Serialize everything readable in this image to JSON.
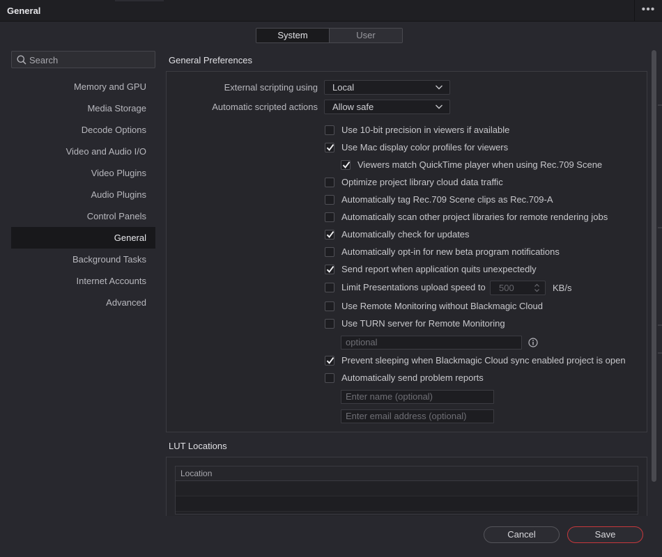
{
  "window": {
    "title": "General",
    "more_label": "•••"
  },
  "segment": {
    "system": "System",
    "user": "User"
  },
  "search": {
    "placeholder": "Search"
  },
  "sidebar": {
    "items": [
      {
        "label": "Memory and GPU"
      },
      {
        "label": "Media Storage"
      },
      {
        "label": "Decode Options"
      },
      {
        "label": "Video and Audio I/O"
      },
      {
        "label": "Video Plugins"
      },
      {
        "label": "Audio Plugins"
      },
      {
        "label": "Control Panels"
      },
      {
        "label": "General"
      },
      {
        "label": "Background Tasks"
      },
      {
        "label": "Internet Accounts"
      },
      {
        "label": "Advanced"
      }
    ],
    "active_index": 7
  },
  "general": {
    "section_title": "General Preferences",
    "external_scripting_label": "External scripting using",
    "external_scripting_value": "Local",
    "auto_actions_label": "Automatic scripted actions",
    "auto_actions_value": "Allow safe",
    "options": [
      {
        "label": "Use 10-bit precision in viewers if available",
        "checked": false
      },
      {
        "label": "Use Mac display color profiles for viewers",
        "checked": true
      },
      {
        "label": "Viewers match QuickTime player when using Rec.709 Scene",
        "checked": true
      },
      {
        "label": "Optimize project library cloud data traffic",
        "checked": false
      },
      {
        "label": "Automatically tag Rec.709 Scene clips as Rec.709-A",
        "checked": false
      },
      {
        "label": "Automatically scan other project libraries for remote rendering jobs",
        "checked": false
      },
      {
        "label": "Automatically check for updates",
        "checked": true
      },
      {
        "label": "Automatically opt-in for new beta program notifications",
        "checked": false
      },
      {
        "label": "Send report when application quits unexpectedly",
        "checked": true
      },
      {
        "label": "Limit Presentations upload speed to",
        "checked": false
      },
      {
        "label": "Use Remote Monitoring without Blackmagic Cloud",
        "checked": false
      },
      {
        "label": "Use TURN server for Remote Monitoring",
        "checked": false
      },
      {
        "label": "Prevent sleeping when Blackmagic Cloud sync enabled project is open",
        "checked": true
      },
      {
        "label": "Automatically send problem reports",
        "checked": false
      }
    ],
    "upload_speed_value": "500",
    "upload_speed_unit": "KB/s",
    "turn_server_placeholder": "optional",
    "name_placeholder": "Enter name (optional)",
    "email_placeholder": "Enter email address (optional)"
  },
  "lut": {
    "section_title": "LUT Locations",
    "column_header": "Location"
  },
  "buttons": {
    "cancel": "Cancel",
    "save": "Save"
  }
}
